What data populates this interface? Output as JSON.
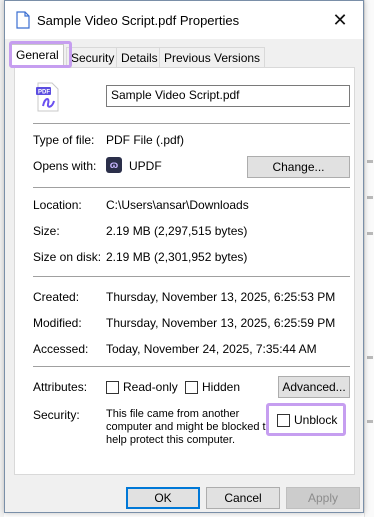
{
  "window": {
    "title": "Sample Video Script.pdf Properties",
    "close_label": "✕"
  },
  "tabs": [
    {
      "label": "General",
      "active": true
    },
    {
      "label": "Security",
      "active": false
    },
    {
      "label": "Details",
      "active": false
    },
    {
      "label": "Previous Versions",
      "active": false
    }
  ],
  "file": {
    "name": "Sample Video Script.pdf",
    "icon": "pdf-file-icon"
  },
  "props": {
    "type_label": "Type of file:",
    "type_value": "PDF File (.pdf)",
    "opens_label": "Opens with:",
    "opens_value": "UPDF",
    "opens_icon": "updf-app-icon",
    "change_label": "Change...",
    "location_label": "Location:",
    "location_value": "C:\\Users\\ansar\\Downloads",
    "size_label": "Size:",
    "size_value": "2.19 MB (2,297,515 bytes)",
    "size_disk_label": "Size on disk:",
    "size_disk_value": "2.19 MB (2,301,952 bytes)",
    "created_label": "Created:",
    "created_value": "Thursday, November 13, 2025, 6:25:53 PM",
    "modified_label": "Modified:",
    "modified_value": "Thursday, November 13, 2025, 6:25:59 PM",
    "accessed_label": "Accessed:",
    "accessed_value": "Today, November 24, 2025, 7:35:44 AM",
    "attributes_label": "Attributes:",
    "readonly_label": "Read-only",
    "readonly_checked": false,
    "hidden_label": "Hidden",
    "hidden_checked": false,
    "advanced_label": "Advanced...",
    "security_label": "Security:",
    "security_text": "This file came from another computer and might be blocked to help protect this computer.",
    "unblock_label": "Unblock",
    "unblock_checked": false
  },
  "footer": {
    "ok_label": "OK",
    "cancel_label": "Cancel",
    "apply_label": "Apply"
  },
  "colors": {
    "highlight": "#c69ef0",
    "accent": "#0078d7"
  }
}
